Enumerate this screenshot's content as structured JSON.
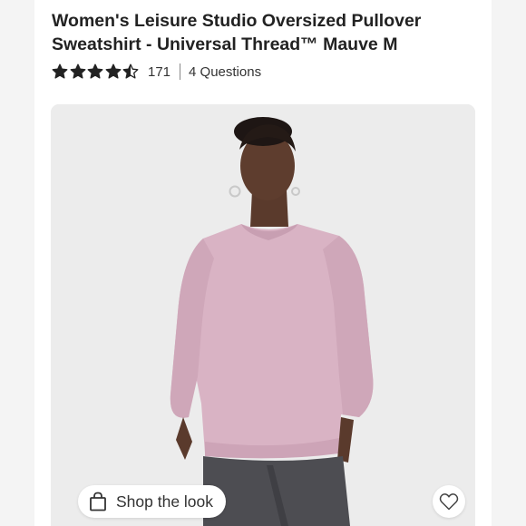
{
  "product": {
    "title": "Women's Leisure Studio Oversized Pullover Sweatshirt - Universal Thread™ Mauve M",
    "rating": {
      "stars": 4.5,
      "max": 5,
      "count": "171"
    },
    "questions_link": "4 Questions"
  },
  "image": {
    "description_icon": "product-photo",
    "sweatshirt_color": "#d9b3c4"
  },
  "actions": {
    "shop_the_look": "Shop the look",
    "shop_icon": "shopping-bag-icon",
    "favorite_icon": "heart-icon"
  }
}
